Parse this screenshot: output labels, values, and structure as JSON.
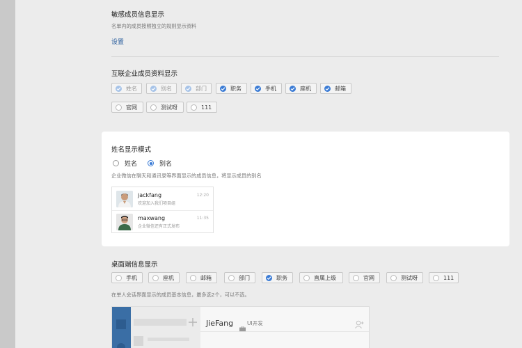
{
  "sensitive": {
    "title": "敏感成员信息显示",
    "desc": "名单内的成员按照独立的规则显示资料",
    "link": "设置"
  },
  "external": {
    "title": "互联企业成员资料显示",
    "row1": [
      {
        "label": "姓名",
        "state": "disabled"
      },
      {
        "label": "别名",
        "state": "disabled"
      },
      {
        "label": "部门",
        "state": "disabled"
      },
      {
        "label": "职务",
        "state": "checked"
      },
      {
        "label": "手机",
        "state": "checked"
      },
      {
        "label": "座机",
        "state": "checked"
      },
      {
        "label": "邮箱",
        "state": "checked"
      }
    ],
    "row2": [
      {
        "label": "官网",
        "state": "unchecked"
      },
      {
        "label": "测试呀",
        "state": "unchecked"
      },
      {
        "label": "111",
        "state": "unchecked"
      }
    ]
  },
  "nameMode": {
    "title": "姓名显示模式",
    "options": [
      {
        "label": "姓名",
        "selected": false
      },
      {
        "label": "别名",
        "selected": true
      }
    ],
    "desc": "企业微信在聊天和通讯录等界面显示的成员信息，将显示成员的别名",
    "preview": [
      {
        "name": "jackfang",
        "msg": "欢迎加入我们项目组",
        "time": "12:20"
      },
      {
        "name": "maxwang",
        "msg": "企业微信还有正式发布",
        "time": "11:35"
      }
    ]
  },
  "desktop": {
    "title": "桌面端信息显示",
    "chips": [
      {
        "label": "手机",
        "state": "unchecked"
      },
      {
        "label": "座机",
        "state": "unchecked"
      },
      {
        "label": "邮箱",
        "state": "unchecked"
      },
      {
        "label": "部门",
        "state": "unchecked"
      },
      {
        "label": "职务",
        "state": "checked"
      },
      {
        "label": "直属上级",
        "state": "unchecked"
      },
      {
        "label": "官网",
        "state": "unchecked"
      },
      {
        "label": "测试呀",
        "state": "unchecked"
      },
      {
        "label": "111",
        "state": "unchecked"
      }
    ],
    "desc": "在单人会话界面显示的成员基本信息，最多选2个，可以不选。",
    "mock": {
      "name": "JieFang",
      "dept": "UI开发"
    }
  },
  "colors": {
    "accent": "#3a7bd5",
    "link": "#2c5f9e"
  }
}
